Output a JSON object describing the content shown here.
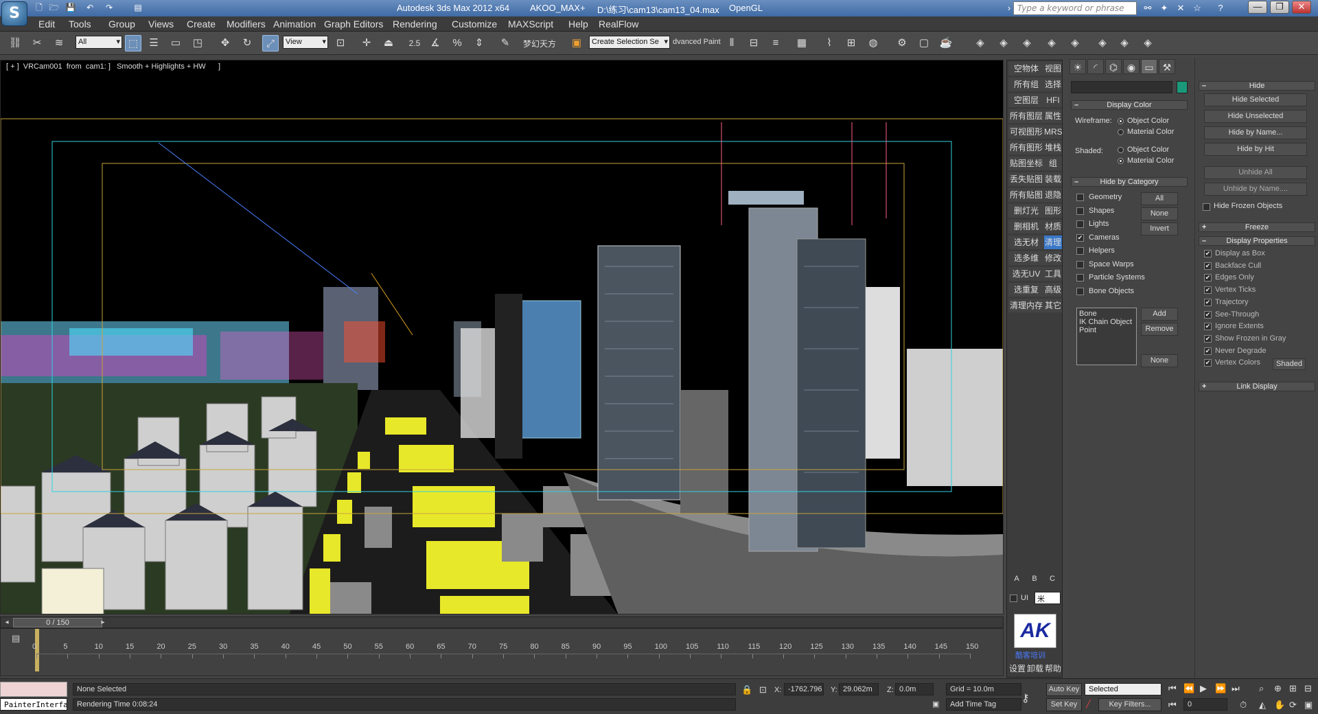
{
  "window": {
    "title_app": "Autodesk 3ds Max  2012 x64",
    "title_user": "AKOO_MAX+",
    "title_file": "D:\\练习\\cam13\\cam13_04.max",
    "title_renderer": "OpenGL",
    "search_placeholder": "Type a keyword or phrase",
    "min_label": "—",
    "restore_label": "❐",
    "close_label": "✕"
  },
  "menu": [
    "Edit",
    "Tools",
    "Group",
    "Views",
    "Create",
    "Modifiers",
    "Animation",
    "Graph Editors",
    "Rendering",
    "Customize",
    "MAXScript",
    "Help",
    "RealFlow"
  ],
  "toolbar": {
    "filter_value": "All",
    "refcoord_value": "View",
    "snap_label": "2.5",
    "chinese_label": "梦幻天方",
    "named_sel_placeholder": "Create Selection Se",
    "advanced_paint_label": "dvanced Paint"
  },
  "viewport": {
    "label": "[ + ]  VRCam001  from  cam1: ]   Smooth + Highlights + HW      ]"
  },
  "timeline": {
    "slider_label": "0 / 150",
    "ticks": [
      "0",
      "5",
      "10",
      "15",
      "20",
      "25",
      "30",
      "35",
      "40",
      "45",
      "50",
      "55",
      "60",
      "65",
      "70",
      "75",
      "80",
      "85",
      "90",
      "95",
      "100",
      "105",
      "110",
      "115",
      "120",
      "125",
      "130",
      "135",
      "140",
      "145",
      "150"
    ]
  },
  "script_panel": {
    "rows": [
      [
        "空物体",
        "视图"
      ],
      [
        "所有组",
        "选择"
      ],
      [
        "空图层",
        "HFI"
      ],
      [
        "所有图层",
        "属性"
      ],
      [
        "可视图形",
        "MRS"
      ],
      [
        "所有图形",
        "堆栈"
      ],
      [
        "贴图坐标",
        "组"
      ],
      [
        "丢失贴图",
        "装载"
      ],
      [
        "所有贴图",
        "退隐"
      ],
      [
        "删灯光",
        "图形"
      ],
      [
        "删相机",
        "材质"
      ],
      [
        "选无材",
        "清理"
      ],
      [
        "选多维",
        "修改"
      ],
      [
        "选无UV",
        "工具"
      ],
      [
        "选重复",
        "高级"
      ],
      [
        "清理内存",
        "其它"
      ]
    ],
    "abc": [
      "A",
      "B",
      "C"
    ],
    "ui_label": "UI",
    "ui_value": "米",
    "logo_text": "AK",
    "logo_caption": "酷客培训",
    "bottom": [
      "设置",
      "卸载",
      "帮助"
    ]
  },
  "command_panel": {
    "tabs": [
      "create-icon",
      "modify-icon",
      "hierarchy-icon",
      "motion-icon",
      "display-icon",
      "utilities-icon"
    ],
    "swatch_color": "#1a9a7a",
    "display_color": {
      "title": "Display Color",
      "wireframe_label": "Wireframe:",
      "shaded_label": "Shaded:",
      "object_color": "Object Color",
      "material_color": "Material Color"
    },
    "hide_by_category": {
      "title": "Hide by Category",
      "items": [
        {
          "label": "Geometry",
          "checked": false
        },
        {
          "label": "Shapes",
          "checked": false
        },
        {
          "label": "Lights",
          "checked": false
        },
        {
          "label": "Cameras",
          "checked": true
        },
        {
          "label": "Helpers",
          "checked": false
        },
        {
          "label": "Space Warps",
          "checked": false
        },
        {
          "label": "Particle Systems",
          "checked": false
        },
        {
          "label": "Bone Objects",
          "checked": false
        }
      ],
      "all_btn": "All",
      "none_btn": "None",
      "invert_btn": "Invert",
      "list_items": [
        "Bone",
        "IK Chain Object",
        "Point"
      ],
      "add_btn": "Add",
      "remove_btn": "Remove",
      "none2_btn": "None"
    },
    "hide": {
      "title": "Hide",
      "buttons": [
        "Hide Selected",
        "Hide Unselected",
        "Hide by Name...",
        "Hide by Hit",
        "Unhide All",
        "Unhide by Name...."
      ],
      "frozen_label": "Hide Frozen Objects"
    },
    "freeze_title": "Freeze",
    "display_properties": {
      "title": "Display Properties",
      "items": [
        "Display as Box",
        "Backface Cull",
        "Edges Only",
        "Vertex Ticks",
        "Trajectory",
        "See-Through",
        "Ignore Extents",
        "Show Frozen in Gray",
        "Never Degrade",
        "Vertex Colors"
      ],
      "shaded_btn": "Shaded"
    },
    "link_display_title": "Link Display"
  },
  "status": {
    "painter_label": "PainterInterfa",
    "prompt": "None Selected",
    "render_time": "Rendering Time  0:08:24",
    "x_label": "X:",
    "x_value": "-1762.796",
    "y_label": "Y:",
    "y_value": "29.062m",
    "z_label": "Z:",
    "z_value": "0.0m",
    "grid": "Grid = 10.0m",
    "add_time_tag": "Add Time Tag",
    "auto_key": "Auto Key",
    "set_key": "Set Key",
    "selected_value": "Selected",
    "key_filters": "Key Filters...",
    "frame_value": "0"
  }
}
